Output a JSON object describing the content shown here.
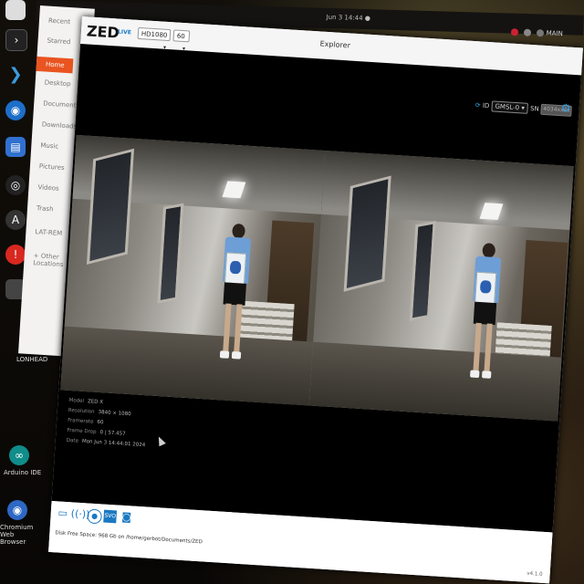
{
  "desktop": {
    "clock": "Jun 3 14:44 ●",
    "tray_user": "MAIN",
    "side_labels": [
      "LONHEAD",
      "Arduino IDE",
      "Chromium Web Browser"
    ]
  },
  "file_manager": {
    "items": [
      "Recent",
      "Starred",
      "Home",
      "Desktop",
      "Documents",
      "Downloads",
      "Music",
      "Pictures",
      "Videos",
      "Trash",
      "LAT-REM",
      "+ Other Locations"
    ],
    "active_index": 2
  },
  "zed": {
    "logo": "ZED",
    "live_label": "LIVE",
    "resolution_select": "HD1080",
    "fps_select": "60",
    "window_title": "Explorer",
    "id_label": "ID",
    "camera_select": "GMSL-0",
    "sn_label": "SN",
    "sn_value": "4034xxxx",
    "info": {
      "model_label": "Model",
      "model_value": "ZED X",
      "resolution_label": "Resolution",
      "resolution_value": "3840 × 1080",
      "framerate_label": "Framerate",
      "framerate_value": "60",
      "frame_drop_label": "Frame Drop",
      "frame_drop_value": "0 | 57.457",
      "date_label": "Date",
      "date_value": "Mon Jun 3 14:44:01 2024"
    },
    "disk_space": "Disk Free Space: 968 Gb  on  /home/gerbot/Documents/ZED",
    "version": "v4.1.0"
  }
}
